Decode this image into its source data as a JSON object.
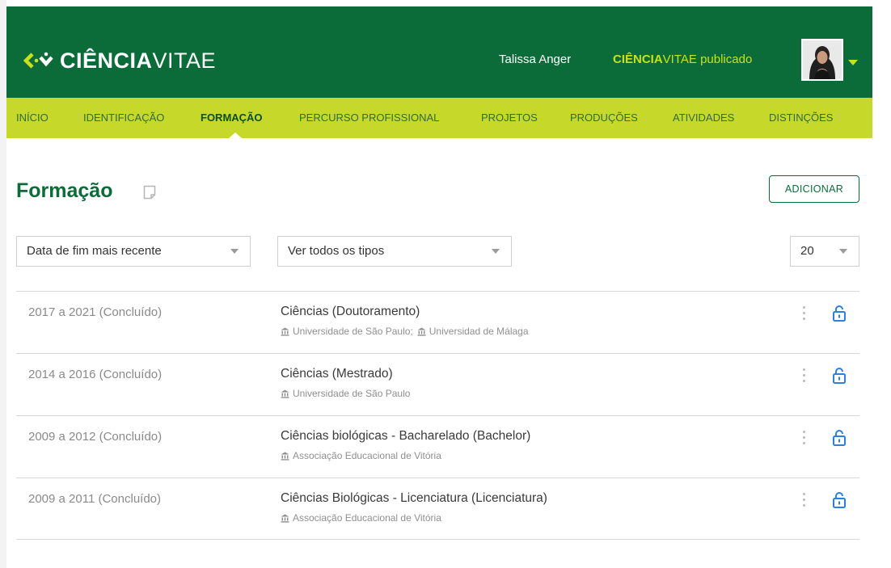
{
  "header": {
    "logo_bold": "CIÊNCIA",
    "logo_light": "VITAE",
    "user_name": "Talissa Anger",
    "published_bold": "CIÊNCIA",
    "published_rest": "VITAE publicado",
    "colors": {
      "header_bg": "#0b6c39",
      "accent": "#c6e21c"
    }
  },
  "nav": {
    "items": [
      {
        "label": "INÍCIO"
      },
      {
        "label": "IDENTIFICAÇÃO"
      },
      {
        "label": "FORMAÇÃO",
        "active": true
      },
      {
        "label": "PERCURSO PROFISSIONAL"
      },
      {
        "label": "PROJETOS"
      },
      {
        "label": "PRODUÇÕES"
      },
      {
        "label": "ATIVIDADES"
      },
      {
        "label": "DISTINÇÕES"
      }
    ]
  },
  "main": {
    "title": "Formação",
    "add_label": "ADICIONAR",
    "sort_value": "Data de fim mais recente",
    "type_value": "Ver todos os tipos",
    "per_page_value": "20",
    "rows": [
      {
        "date": "2017 a 2021 (Concluído)",
        "title": "Ciências (Doutoramento)",
        "inst1": "Universidade de São Paulo;",
        "inst2": "Universidad de Málaga"
      },
      {
        "date": "2014 a 2016 (Concluído)",
        "title": "Ciências (Mestrado)",
        "inst1": "Universidade de São Paulo"
      },
      {
        "date": "2009 a 2012 (Concluído)",
        "title": "Ciências biológicas - Bacharelado (Bachelor)",
        "inst1": "Associação Educacional de Vitória"
      },
      {
        "date": "2009 a 2011 (Concluído)",
        "title": "Ciências Biológicas - Licenciatura (Licenciatura)",
        "inst1": "Associação Educacional de Vitória"
      }
    ]
  }
}
